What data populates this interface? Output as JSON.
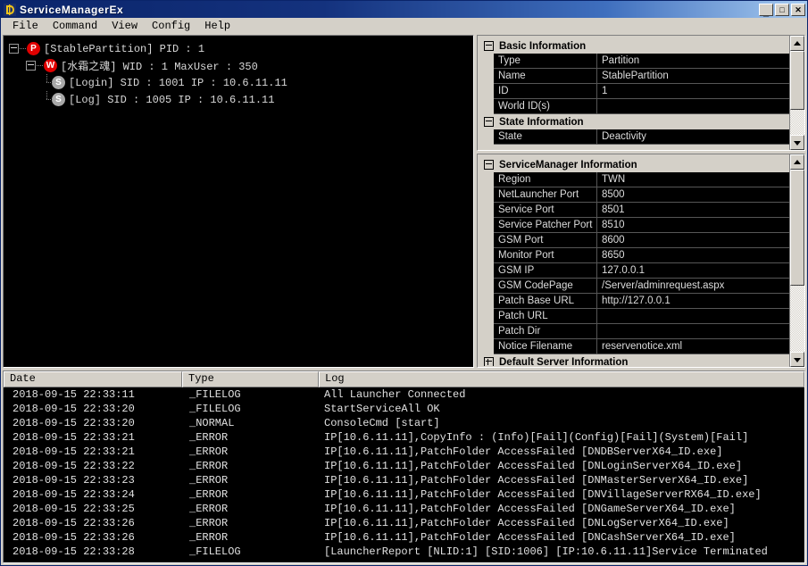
{
  "window": {
    "title": "ServiceManagerEx",
    "icon": "app-icon",
    "buttons": {
      "minimize": "_",
      "maximize": "□",
      "close": "✕"
    }
  },
  "menu": {
    "items": [
      {
        "label": "File"
      },
      {
        "label": "Command"
      },
      {
        "label": "View"
      },
      {
        "label": "Config"
      },
      {
        "label": "Help"
      }
    ]
  },
  "tree": {
    "nodes": [
      {
        "depth": 1,
        "badge": "P",
        "badge_color": "#e00000",
        "expander": "minus",
        "label": "[StablePartition] PID : 1"
      },
      {
        "depth": 2,
        "badge": "W",
        "badge_color": "#e00000",
        "expander": "minus",
        "label": "[水霜之魂] WID : 1 MaxUser : 350"
      },
      {
        "depth": 3,
        "badge": "S",
        "badge_color": "#a8a8a8",
        "expander": "none",
        "label": "[Login] SID : 1001 IP : 10.6.11.11"
      },
      {
        "depth": 3,
        "badge": "S",
        "badge_color": "#a8a8a8",
        "expander": "none",
        "label": "[Log] SID : 1005 IP : 10.6.11.11"
      }
    ]
  },
  "basic_grid": {
    "categories": [
      {
        "title": "Basic Information",
        "state": "expanded",
        "rows": [
          {
            "key": "Type",
            "value": "Partition"
          },
          {
            "key": "Name",
            "value": "StablePartition"
          },
          {
            "key": "ID",
            "value": "1"
          },
          {
            "key": "World ID(s)",
            "value": ""
          }
        ]
      },
      {
        "title": "State Information",
        "state": "expanded",
        "rows": [
          {
            "key": "State",
            "value": "Deactivity"
          }
        ]
      }
    ]
  },
  "sm_grid": {
    "categories": [
      {
        "title": "ServiceManager Information",
        "state": "expanded",
        "rows": [
          {
            "key": "Region",
            "value": "TWN"
          },
          {
            "key": "NetLauncher Port",
            "value": "8500"
          },
          {
            "key": "Service Port",
            "value": "8501"
          },
          {
            "key": "Service Patcher Port",
            "value": "8510"
          },
          {
            "key": "GSM Port",
            "value": "8600"
          },
          {
            "key": "Monitor Port",
            "value": "8650"
          },
          {
            "key": "GSM IP",
            "value": "127.0.0.1"
          },
          {
            "key": "GSM CodePage",
            "value": "/Server/adminrequest.aspx"
          },
          {
            "key": "Patch Base URL",
            "value": "http://127.0.0.1"
          },
          {
            "key": "Patch URL",
            "value": ""
          },
          {
            "key": "Patch Dir",
            "value": ""
          },
          {
            "key": "Notice Filename",
            "value": "reservenotice.xml"
          }
        ]
      },
      {
        "title": "Default Server Information",
        "state": "collapsed",
        "rows": []
      }
    ]
  },
  "log_table": {
    "columns": [
      {
        "label": "Date"
      },
      {
        "label": "Type"
      },
      {
        "label": "Log"
      }
    ],
    "rows": [
      {
        "date": "2018-09-15 22:33:11",
        "type": "_FILELOG",
        "msg": "All Launcher Connected"
      },
      {
        "date": "2018-09-15 22:33:20",
        "type": "_FILELOG",
        "msg": "StartServiceAll OK"
      },
      {
        "date": "2018-09-15 22:33:20",
        "type": "_NORMAL",
        "msg": "ConsoleCmd [start]"
      },
      {
        "date": "2018-09-15 22:33:21",
        "type": "_ERROR",
        "msg": "IP[10.6.11.11],CopyInfo :  (Info)[Fail](Config)[Fail](System)[Fail]"
      },
      {
        "date": "2018-09-15 22:33:21",
        "type": "_ERROR",
        "msg": "IP[10.6.11.11],PatchFolder AccessFailed [DNDBServerX64_ID.exe]"
      },
      {
        "date": "2018-09-15 22:33:22",
        "type": "_ERROR",
        "msg": "IP[10.6.11.11],PatchFolder AccessFailed [DNLoginServerX64_ID.exe]"
      },
      {
        "date": "2018-09-15 22:33:23",
        "type": "_ERROR",
        "msg": "IP[10.6.11.11],PatchFolder AccessFailed [DNMasterServerX64_ID.exe]"
      },
      {
        "date": "2018-09-15 22:33:24",
        "type": "_ERROR",
        "msg": "IP[10.6.11.11],PatchFolder AccessFailed [DNVillageServerRX64_ID.exe]"
      },
      {
        "date": "2018-09-15 22:33:25",
        "type": "_ERROR",
        "msg": "IP[10.6.11.11],PatchFolder AccessFailed [DNGameServerX64_ID.exe]"
      },
      {
        "date": "2018-09-15 22:33:26",
        "type": "_ERROR",
        "msg": "IP[10.6.11.11],PatchFolder AccessFailed [DNLogServerX64_ID.exe]"
      },
      {
        "date": "2018-09-15 22:33:26",
        "type": "_ERROR",
        "msg": "IP[10.6.11.11],PatchFolder AccessFailed [DNCashServerX64_ID.exe]"
      },
      {
        "date": "2018-09-15 22:33:28",
        "type": "_FILELOG",
        "msg": "[LauncherReport [NLID:1] [SID:1006] [IP:10.6.11.11]Service Terminated"
      }
    ]
  },
  "colors": {
    "titlebar_start": "#0a246a",
    "titlebar_end": "#a6caf0",
    "chrome": "#d4d0c8",
    "grid_bg": "#000000",
    "grid_text": "#dcdcdc",
    "badge_red": "#e00000",
    "badge_gray": "#a8a8a8"
  }
}
